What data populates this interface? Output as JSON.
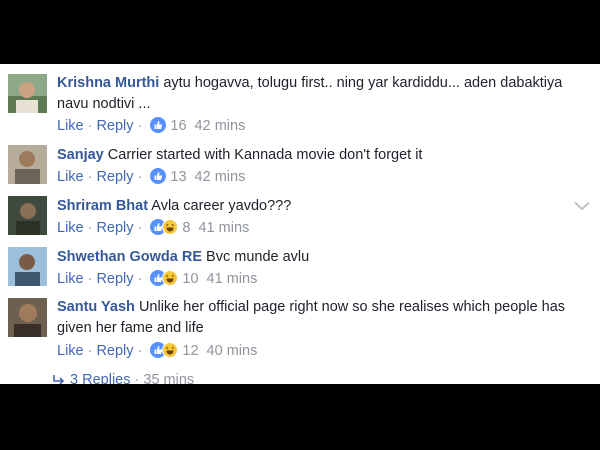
{
  "comments": [
    {
      "author": "Krishna Murthi",
      "text": "aytu hogavva, tolugu first.. ning yar kardiddu... aden dabaktiya navu nodtivi ...",
      "like": "Like",
      "reply": "Reply",
      "count": "16",
      "time": "42 mins",
      "reactions": [
        "like-icon"
      ],
      "avatar_color": "#6a8a5a"
    },
    {
      "author": "Sanjay",
      "text": "Carrier started with Kannada movie don't forget it",
      "like": "Like",
      "reply": "Reply",
      "count": "13",
      "time": "42 mins",
      "reactions": [
        "like-icon"
      ],
      "avatar_color": "#8a7a6a"
    },
    {
      "author": "Shriram Bhat",
      "text": "Avla career yavdo???",
      "like": "Like",
      "reply": "Reply",
      "count": "8",
      "time": "41 mins",
      "reactions": [
        "like-icon",
        "haha-icon"
      ],
      "avatar_color": "#4a5a4a"
    },
    {
      "author": "Shwethan Gowda RE",
      "text": "Bvc munde avlu",
      "like": "Like",
      "reply": "Reply",
      "count": "10",
      "time": "41 mins",
      "reactions": [
        "like-icon",
        "haha-icon"
      ],
      "avatar_color": "#6a94b8"
    },
    {
      "author": "Santu Yash",
      "text": "Unlike her official page right now so she realises which people has given her fame and life",
      "like": "Like",
      "reply": "Reply",
      "count": "12",
      "time": "40 mins",
      "reactions": [
        "like-icon",
        "haha-icon"
      ],
      "avatar_color": "#5a4a3a"
    }
  ],
  "replies": {
    "label": "3 Replies",
    "time": "35 mins"
  },
  "colors": {
    "link": "#365899",
    "action": "#4267b2",
    "meta": "#90949c",
    "like_blue": "#5890ff",
    "haha_yellow": "#f7c73b"
  }
}
